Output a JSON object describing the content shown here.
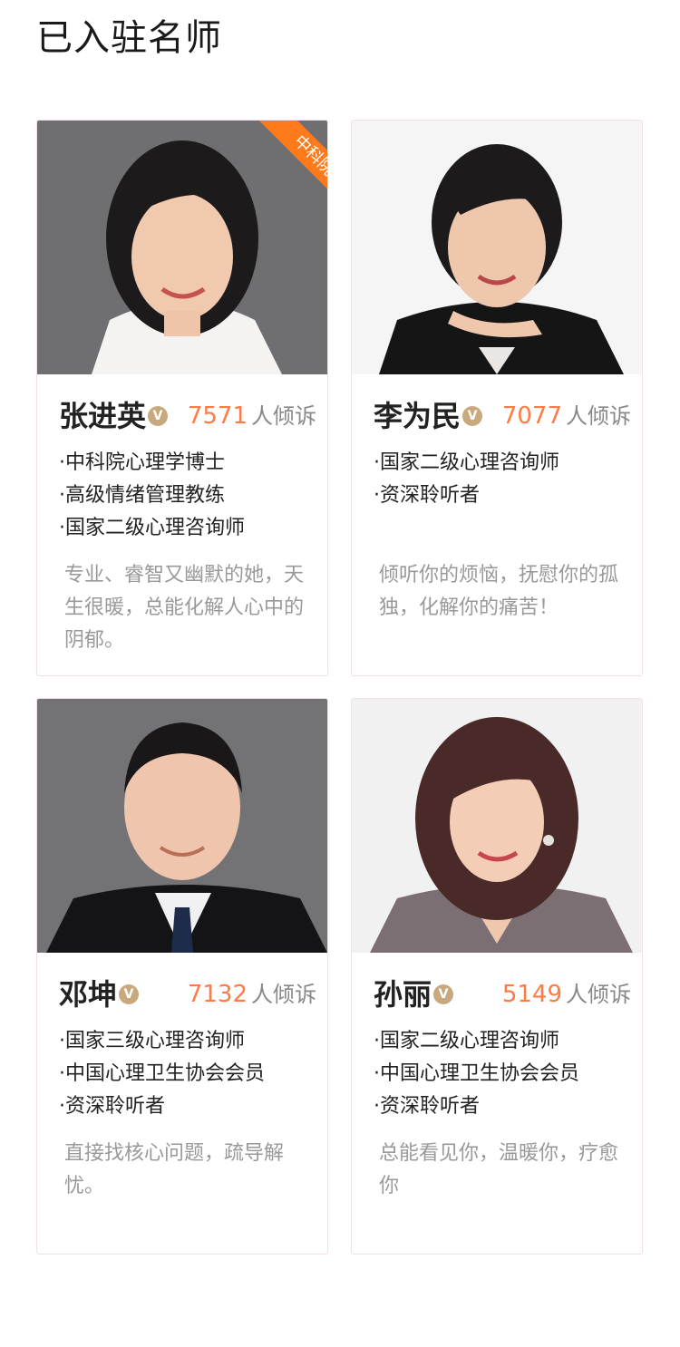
{
  "page": {
    "title": "已入驻名师"
  },
  "teachers": [
    {
      "name": "张进英",
      "verified_badge": "V",
      "ribbon": "中科院",
      "count": "7571",
      "count_label": "人倾诉",
      "qualifications": [
        "·中科院心理学博士",
        "·高级情绪管理教练",
        "·国家二级心理咨询师"
      ],
      "description": "专业、睿智又幽默的她，天生很暖，总能化解人心中的阴郁。"
    },
    {
      "name": "李为民",
      "verified_badge": "V",
      "count": "7077",
      "count_label": "人倾诉",
      "qualifications": [
        "·国家二级心理咨询师",
        "·资深聆听者"
      ],
      "description": "倾听你的烦恼，抚慰你的孤独，化解你的痛苦！"
    },
    {
      "name": "邓坤",
      "verified_badge": "V",
      "count": "7132",
      "count_label": "人倾诉",
      "qualifications": [
        "·国家三级心理咨询师",
        "·中国心理卫生协会会员",
        "·资深聆听者"
      ],
      "description": "直接找核心问题，疏导解忧。"
    },
    {
      "name": "孙丽",
      "verified_badge": "V",
      "count": "5149",
      "count_label": "人倾诉",
      "qualifications": [
        "·国家二级心理咨询师",
        "·中国心理卫生协会会员",
        "·资深聆听者"
      ],
      "description": "总能看见你，温暖你，疗愈你"
    }
  ],
  "colors": {
    "accent_count": "#ff7b45",
    "ribbon": "#ff7a1a",
    "badge": "#c7a97d",
    "card_border": "#f2dfee",
    "description_text": "#999999"
  }
}
